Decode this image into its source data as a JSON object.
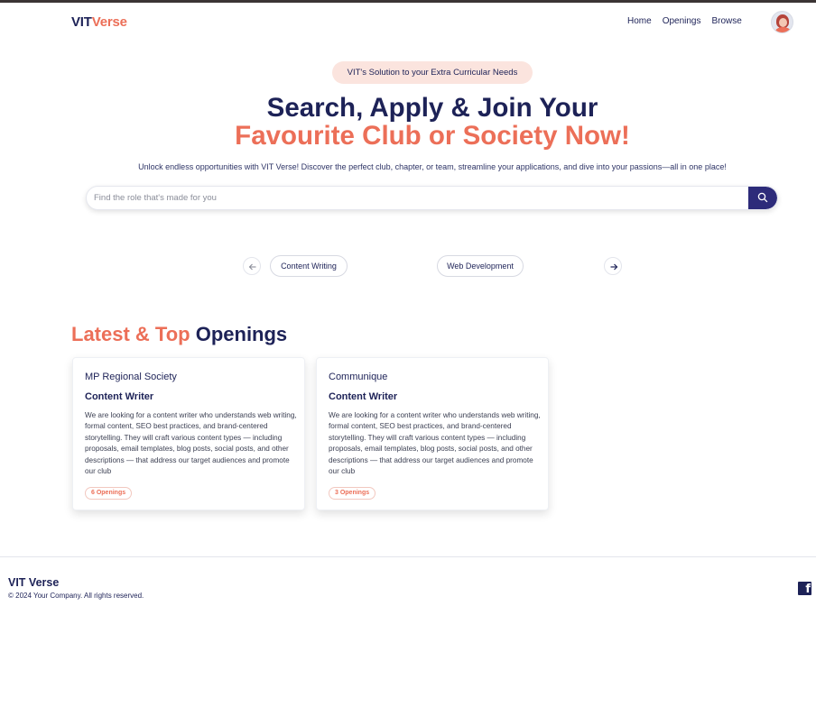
{
  "navbar": {
    "logo_part1": "VIT",
    "logo_part2": "Verse",
    "links": [
      "Home",
      "Openings",
      "Browse"
    ]
  },
  "hero": {
    "pill": "VIT's Solution to your Extra Curricular Needs",
    "title_line1": "Search, Apply & Join Your",
    "title_line2": "Favourite Club or Society Now!",
    "subtitle": "Unlock endless opportunities with VIT Verse! Discover the perfect club, chapter, or team, streamline your applications, and dive into your passions—all in one place!"
  },
  "search": {
    "placeholder": "Find the role that's made for you",
    "value": ""
  },
  "carousel": {
    "chips": [
      "Content Writing",
      "Web Development"
    ]
  },
  "section": {
    "title_part1": "Latest & Top",
    "title_part2": "Openings"
  },
  "cards": [
    {
      "org": "MP Regional Society",
      "role": "Content Writer",
      "description": "We are looking for a content writer who understands web writing, formal content, SEO best practices, and brand-centered storytelling. They will craft various content types — including proposals, email templates, blog posts, social posts, and other descriptions — that address our target audiences and promote our club",
      "badge": "6 Openings"
    },
    {
      "org": "Communique",
      "role": "Content Writer",
      "description": "We are looking for a content writer who understands web writing, formal content, SEO best practices, and brand-centered storytelling. They will craft various content types — including proposals, email templates, blog posts, social posts, and other descriptions — that address our target audiences and promote our club",
      "badge": "3 Openings"
    }
  ],
  "footer": {
    "brand": "VIT Verse",
    "copyright": "© 2024 Your Company. All rights reserved."
  },
  "colors": {
    "primary": "#1d2257",
    "accent": "#ec6f58",
    "search_button": "#2d2b7a",
    "pill_bg": "#fbe4de"
  },
  "icons": {
    "search_button": "search-icon",
    "prev": "arrow-left-icon",
    "next": "arrow-right-icon",
    "social": "facebook-icon",
    "profile": "avatar"
  }
}
